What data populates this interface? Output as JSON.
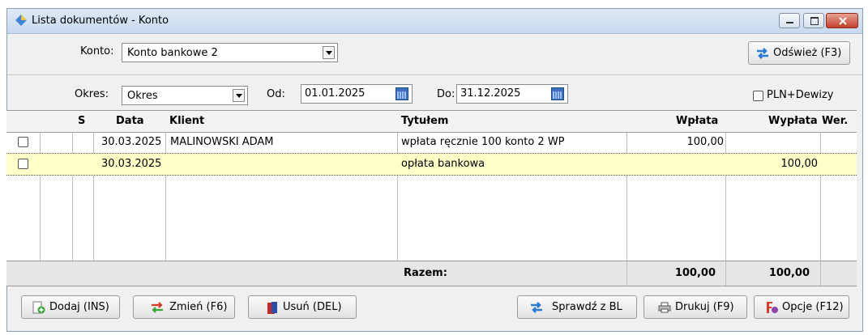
{
  "window": {
    "title": "Lista dokumentów - Konto"
  },
  "konto": {
    "label": "Konto:",
    "value": "Konto bankowe 2"
  },
  "refresh_button": {
    "label": "Odśwież (F3)"
  },
  "okres": {
    "label": "Okres:",
    "value": "Okres"
  },
  "od": {
    "label": "Od:",
    "value": "01.01.2025"
  },
  "do": {
    "label": "Do:",
    "value": "31.12.2025"
  },
  "pln_dewizy": {
    "label": "PLN+Dewizy"
  },
  "table": {
    "headers": {
      "s": "S",
      "data": "Data",
      "klient": "Klient",
      "tytulem": "Tytułem",
      "wplata": "Wpłata",
      "wyplata": "Wypłata",
      "wer": "Wer."
    },
    "rows": [
      {
        "data": "30.03.2025",
        "klient": "MALINOWSKI ADAM",
        "tytulem": "wpłata ręcznie 100 konto 2 WP",
        "wplata": "100,00",
        "wyplata": ""
      },
      {
        "data": "30.03.2025",
        "klient": "",
        "tytulem": "opłata bankowa",
        "wplata": "",
        "wyplata": "100,00"
      }
    ]
  },
  "totals": {
    "label": "Razem:",
    "wplata": "100,00",
    "wyplata": "100,00"
  },
  "buttons": {
    "dodaj": "Dodaj (INS)",
    "zmien": "Zmień (F6)",
    "usun": "Usuń (DEL)",
    "sprawdz": "Sprawdź z BL",
    "drukuj": "Drukuj (F9)",
    "opcje": "Opcje (F12)"
  },
  "colors": {
    "selected_row": "#ffffc8",
    "titlebar": "#d5e3f3",
    "close": "#c4412c"
  },
  "icons": [
    "diamond-app-icon",
    "minimize-icon",
    "maximize-icon",
    "close-icon",
    "refresh-arrows-icon",
    "calendar-icon",
    "add-document-icon",
    "swap-arrows-icon",
    "trash-icon",
    "printer-icon",
    "options-icon"
  ]
}
